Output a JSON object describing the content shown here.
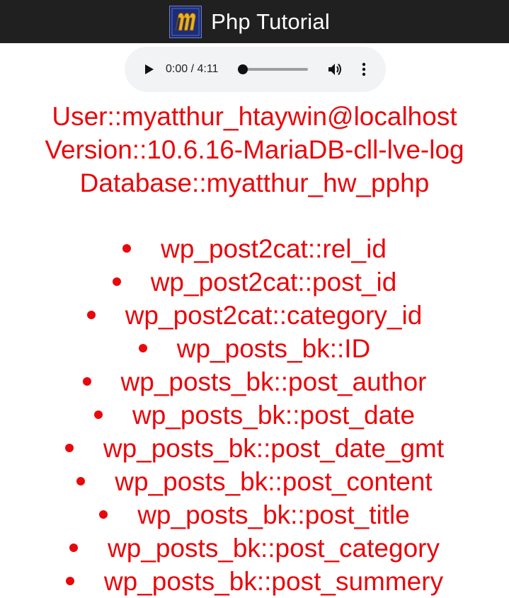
{
  "app_bar": {
    "logo_icon": "php-tutorial-logo-icon",
    "title": "Php Tutorial"
  },
  "audio_player": {
    "time": "0:00 / 4:11",
    "progress": 0.0,
    "play_icon": "play-icon",
    "volume_icon": "volume-icon",
    "more_icon": "more-vertical-icon"
  },
  "info": {
    "user": "User::myatthur_htaywin@localhost",
    "version": "Version::10.6.16-MariaDB-cll-lve-log",
    "database": "Database::myatthur_hw_pphp"
  },
  "columns": [
    "wp_post2cat::rel_id",
    "wp_post2cat::post_id",
    "wp_post2cat::category_id",
    "wp_posts_bk::ID",
    "wp_posts_bk::post_author",
    "wp_posts_bk::post_date",
    "wp_posts_bk::post_date_gmt",
    "wp_posts_bk::post_content",
    "wp_posts_bk::post_title",
    "wp_posts_bk::post_category",
    "wp_posts_bk::post_summery"
  ],
  "colors": {
    "text_red": "#e8080c",
    "app_bar_bg": "#202020",
    "player_bg": "#f1f3f4"
  }
}
